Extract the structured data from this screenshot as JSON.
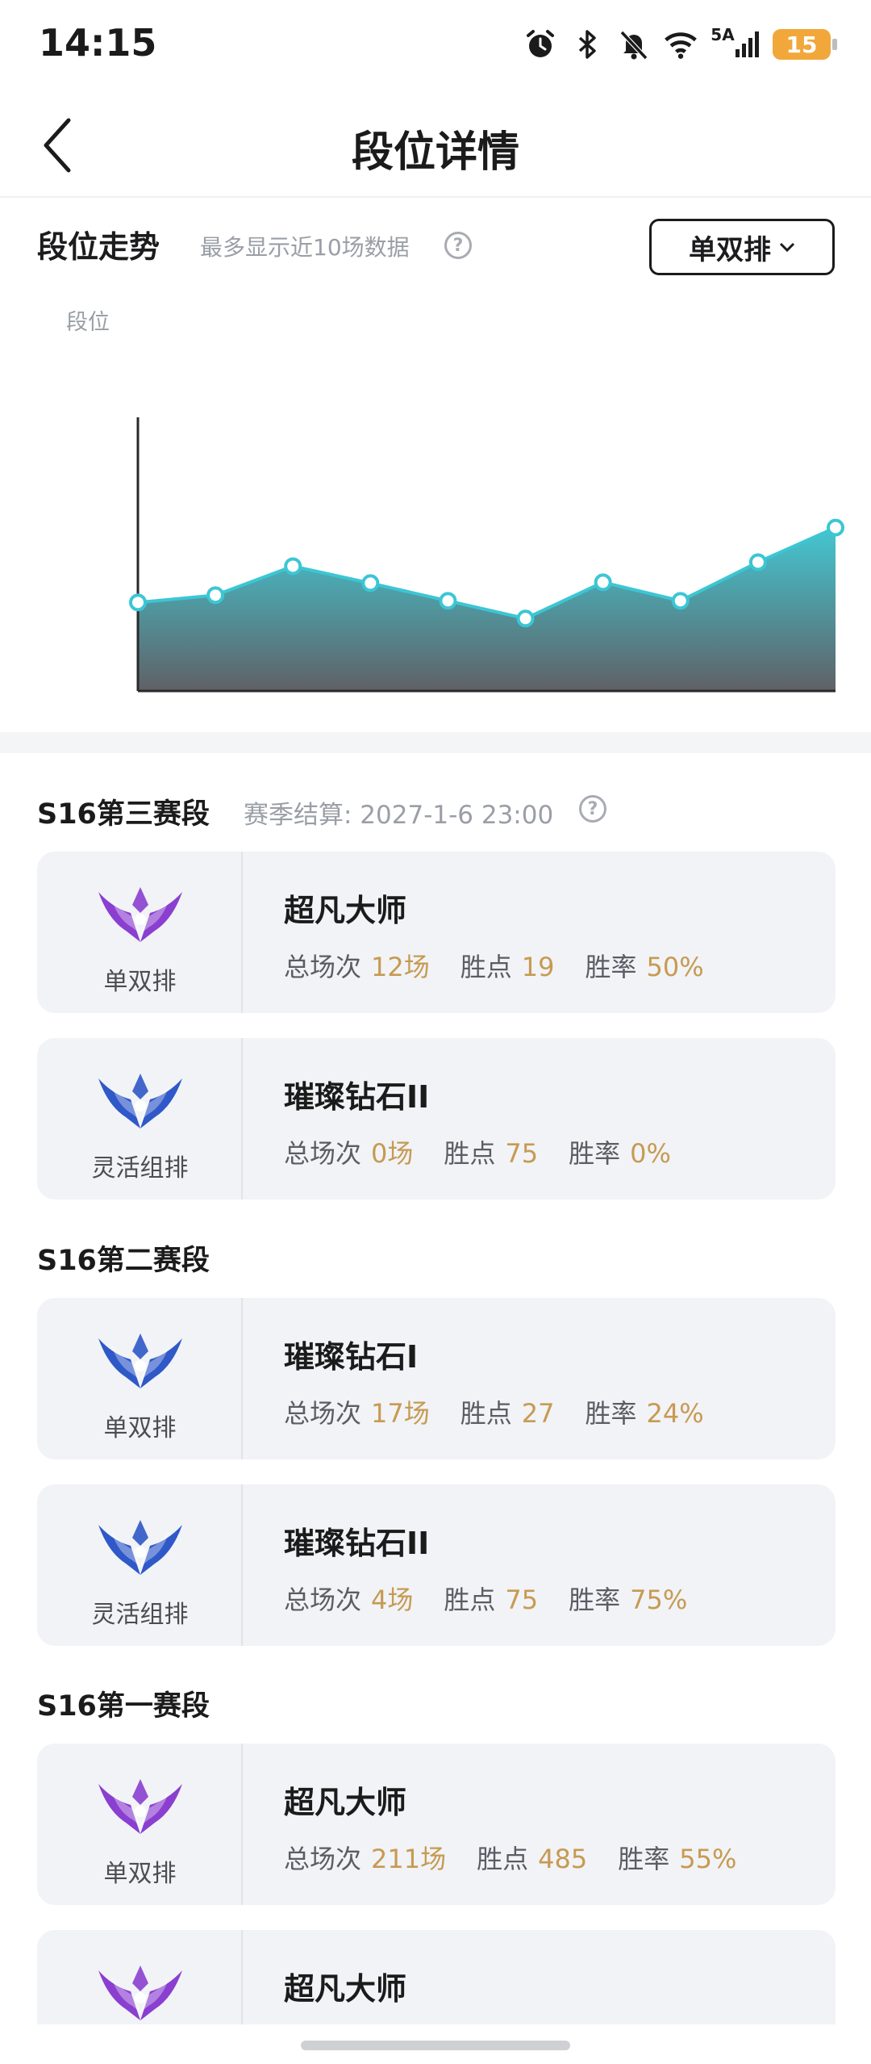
{
  "status_bar": {
    "time": "14:15",
    "network_type": "5A",
    "battery": "15",
    "icons": [
      "alarm-icon",
      "bluetooth-icon",
      "mute-icon",
      "wifi-icon",
      "signal-icon",
      "battery-icon"
    ]
  },
  "nav": {
    "title": "段位详情",
    "back_icon": "chevron-left-icon"
  },
  "trend": {
    "title": "段位走势",
    "note": "最多显示近10场数据",
    "help_icon": "help-circle-icon",
    "queue_selected": "单双排",
    "ylabel": "段位"
  },
  "chart_data": {
    "type": "area",
    "title": "",
    "ylabel": "段位",
    "x": [
      1,
      2,
      3,
      4,
      5,
      6,
      7,
      8,
      9,
      10
    ],
    "series": [
      {
        "values": [
          110,
          119,
          155,
          134,
          112,
          90,
          135,
          112,
          160,
          203
        ]
      }
    ],
    "ylim": [
      0,
      340
    ],
    "grid": false,
    "colors": {
      "line": "#3cc6d4",
      "fill_top": "#43c7d2",
      "fill_bottom": "#5f6166"
    }
  },
  "seasons": [
    {
      "title": "S16第三赛段",
      "settle": "赛季结算: 2027-1-6 23:00",
      "cards": [
        {
          "badge": "purple",
          "queue": "单双排",
          "rank": "超凡大师",
          "games_label": "总场次",
          "games": "12场",
          "points_label": "胜点",
          "points": "19",
          "rate_label": "胜率",
          "rate": "50%"
        },
        {
          "badge": "blue",
          "queue": "灵活组排",
          "rank": "璀璨钻石II",
          "games_label": "总场次",
          "games": "0场",
          "points_label": "胜点",
          "points": "75",
          "rate_label": "胜率",
          "rate": "0%"
        }
      ]
    },
    {
      "title": "S16第二赛段",
      "cards": [
        {
          "badge": "blue",
          "queue": "单双排",
          "rank": "璀璨钻石I",
          "games_label": "总场次",
          "games": "17场",
          "points_label": "胜点",
          "points": "27",
          "rate_label": "胜率",
          "rate": "24%"
        },
        {
          "badge": "blue",
          "queue": "灵活组排",
          "rank": "璀璨钻石II",
          "games_label": "总场次",
          "games": "4场",
          "points_label": "胜点",
          "points": "75",
          "rate_label": "胜率",
          "rate": "75%"
        }
      ]
    },
    {
      "title": "S16第一赛段",
      "cards": [
        {
          "badge": "purple",
          "queue": "单双排",
          "rank": "超凡大师",
          "games_label": "总场次",
          "games": "211场",
          "points_label": "胜点",
          "points": "485",
          "rate_label": "胜率",
          "rate": "55%"
        },
        {
          "badge": "purple",
          "rank": "超凡大师"
        }
      ]
    }
  ],
  "badge_colors": {
    "purple": "#8a3fd0",
    "blue": "#2f58c8"
  }
}
